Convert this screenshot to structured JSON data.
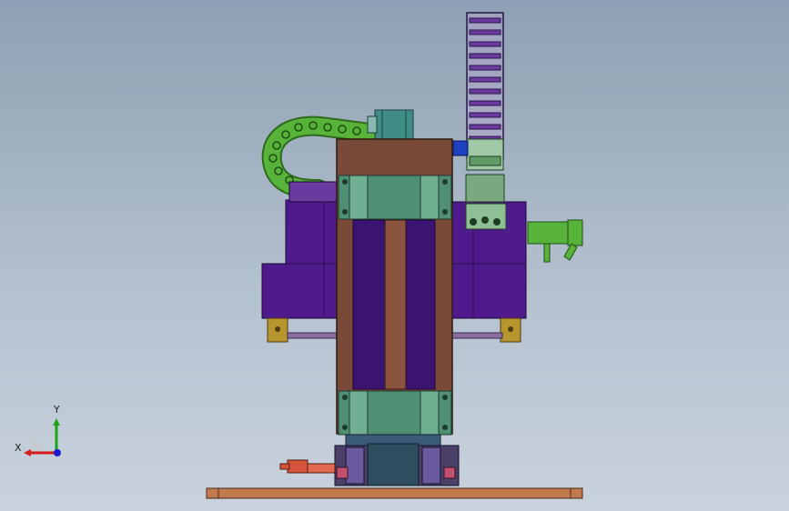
{
  "viewport": {
    "background_top": "#8ea0b3",
    "background_bottom": "#c9d3de"
  },
  "colors": {
    "frame_brown": "#7a4a38",
    "plate_purple": "#4f1a8c",
    "carriage_green": "#4f8f74",
    "chain_green": "#58b33a",
    "chain_purple": "#6a3aa0",
    "motor_teal": "#3f8d86",
    "bracket_gold": "#b8962e",
    "base_copper": "#c07a4e",
    "cylinder_red": "#d4553a",
    "motor_blue": "#1e3fc0"
  },
  "triad": {
    "x_label": "X",
    "y_label": "Y",
    "x_color": "#d41a1a",
    "y_color": "#1aa61a",
    "z_color": "#1a1ad4",
    "icon": "coordinate-triad-icon"
  }
}
